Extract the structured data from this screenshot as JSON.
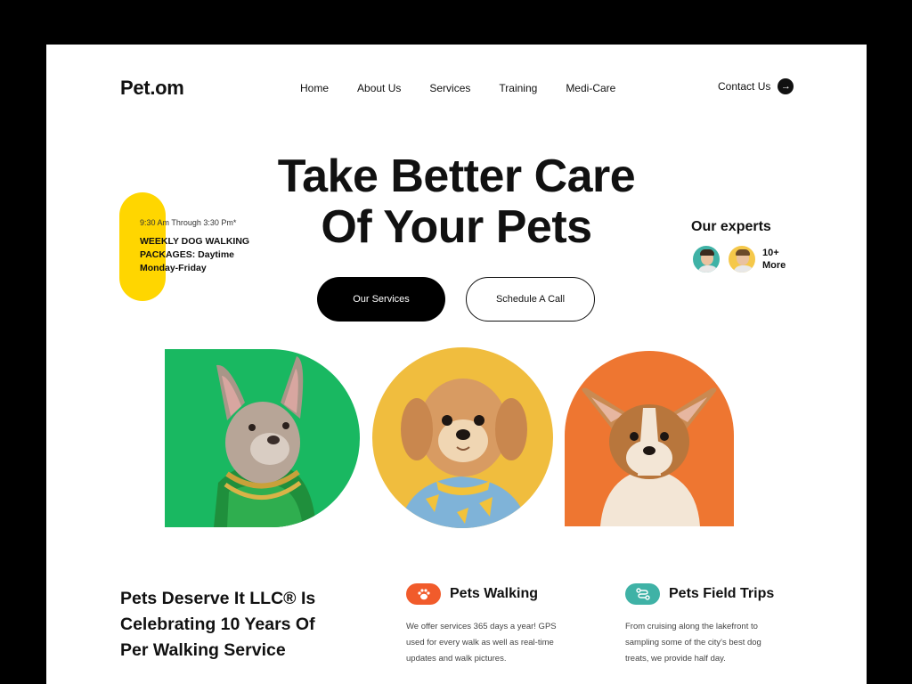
{
  "brand": {
    "logo": "Pet.om"
  },
  "nav": {
    "items": [
      "Home",
      "About Us",
      "Services",
      "Training",
      "Medi-Care"
    ]
  },
  "contact": {
    "label": "Contact Us",
    "icon": "arrow-right-icon"
  },
  "hero": {
    "title_line1": "Take Better Care",
    "title_line2": "Of Your Pets",
    "primary_button": "Our Services",
    "secondary_button": "Schedule A Call"
  },
  "schedule": {
    "time": "9:30 Am Through 3:30 Pm*",
    "line1": "WEEKLY DOG WALKING",
    "line2": "PACKAGES: Daytime",
    "line3": "Monday-Friday"
  },
  "experts": {
    "title": "Our experts",
    "more_count": "10+",
    "more_label": "More"
  },
  "about": {
    "line1": "Pets Deserve It LLC® Is",
    "line2": "Celebrating 10 Years Of",
    "line3": "Per Walking Service"
  },
  "services": [
    {
      "name": "Pets Walking",
      "icon": "paw-icon",
      "color": "#f15b2b",
      "text": "We offer services 365 days a year! GPS used for every walk as well as real-time updates and walk pictures."
    },
    {
      "name": "Pets Field Trips",
      "icon": "route-icon",
      "color": "#3fb2a6",
      "text": "From cruising along the lakefront to sampling some of the city's best dog treats, we provide half day."
    }
  ],
  "colors": {
    "accent_yellow": "#ffd600",
    "green": "#19b861",
    "mustard": "#f0bd3e",
    "orange": "#ee7631",
    "teal": "#3fb2a6"
  }
}
